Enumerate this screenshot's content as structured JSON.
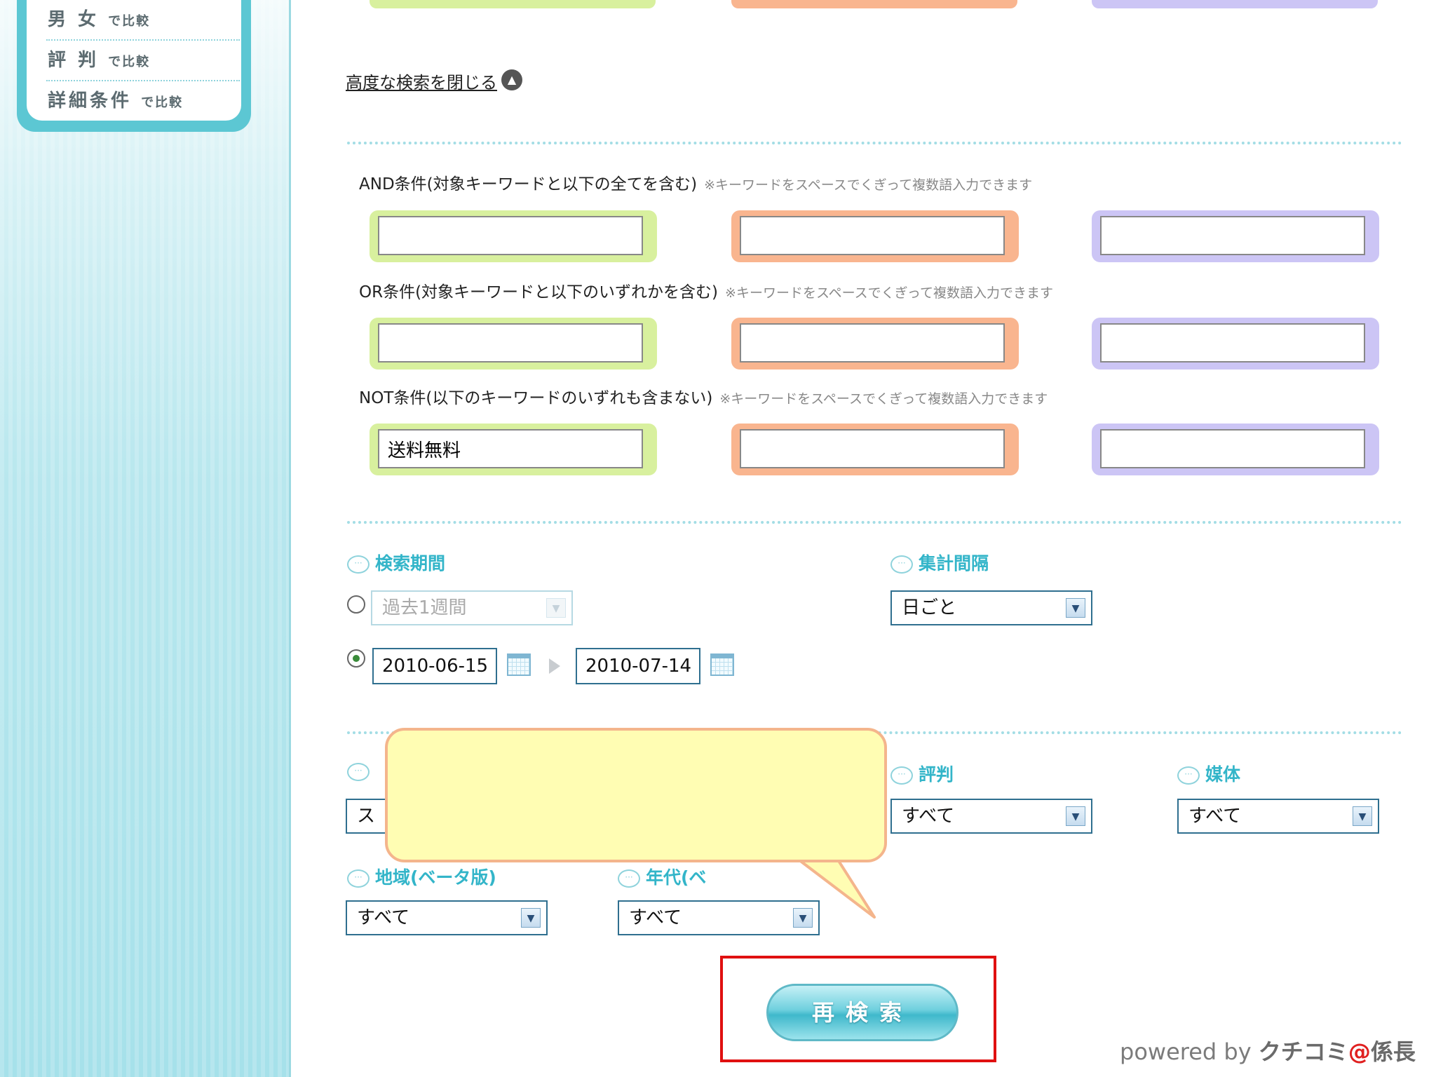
{
  "sidebar": {
    "items": [
      {
        "main": "男 女",
        "suffix": "で比較"
      },
      {
        "main": "評 判",
        "suffix": "で比較"
      },
      {
        "main": "詳細条件",
        "suffix": "で比較"
      }
    ]
  },
  "search": {
    "close_link": "高度な検索を閉じる",
    "and_label": "AND条件(対象キーワードと以下の全てを含む)",
    "or_label": "OR条件(対象キーワードと以下のいずれかを含む)",
    "not_label": "NOT条件(以下のキーワードのいずれも含まない)",
    "note": "※キーワードをスペースでくぎって複数語入力できます",
    "and_values": [
      "",
      "",
      ""
    ],
    "or_values": [
      "",
      "",
      ""
    ],
    "not_values": [
      "送料無料",
      "",
      ""
    ]
  },
  "period": {
    "title": "検索期間",
    "preset": "過去1週間",
    "date_from": "2010-06-15",
    "date_to": "2010-07-14"
  },
  "interval": {
    "title": "集計間隔",
    "value": "日ごと"
  },
  "filters": {
    "first_value_partial": "ス",
    "reputation_title": "評判",
    "reputation_value": "すべて",
    "media_title": "媒体",
    "media_value": "すべて",
    "region_title": "地域(ベータ版)",
    "region_value": "すべて",
    "age_title_partial": "年代(ベ",
    "age_value": "すべて"
  },
  "button": {
    "research_label": "再検索"
  },
  "footer": {
    "powered_prefix": "powered by",
    "brand_part1": "クチコミ",
    "brand_at": "@",
    "brand_part2": "係長"
  },
  "colors": {
    "accent": "#33b5c9",
    "green": "#d8f09e",
    "orange": "#f9b58f",
    "purple": "#ccc5f5",
    "highlight": "#e01010"
  }
}
